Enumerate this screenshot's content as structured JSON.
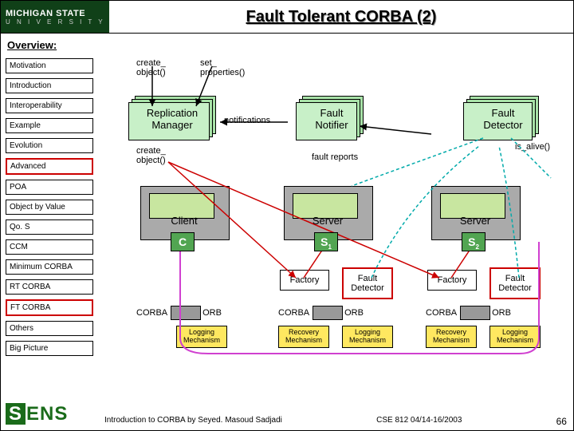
{
  "header": {
    "logo_line1": "MICHIGAN STATE",
    "logo_line2": "U N I V E R S I T Y",
    "title": "Fault Tolerant CORBA (2)"
  },
  "subtitle": "Overview:",
  "sidebar": {
    "items": [
      {
        "label": "Motivation",
        "hl": false
      },
      {
        "label": "Introduction",
        "hl": false
      },
      {
        "label": "Interoperability",
        "hl": false
      },
      {
        "label": "Example",
        "hl": false
      },
      {
        "label": "Evolution",
        "hl": false
      },
      {
        "label": "Advanced",
        "hl": true
      },
      {
        "label": "POA",
        "hl": false
      },
      {
        "label": "Object by Value",
        "hl": false
      },
      {
        "label": "Qo. S",
        "hl": false
      },
      {
        "label": "CCM",
        "hl": false
      },
      {
        "label": "Minimum CORBA",
        "hl": false
      },
      {
        "label": "RT CORBA",
        "hl": false
      },
      {
        "label": "FT CORBA",
        "hl": true
      },
      {
        "label": "Others",
        "hl": false
      }
    ],
    "big_picture": "Big Picture"
  },
  "diagram": {
    "create_obj_top": "create_\nobject()",
    "set_props": "set_\nproperties()",
    "replication_mgr": "Replication\nManager",
    "notifications": "notifications",
    "fault_notifier": "Fault\nNotifier",
    "fault_detector_top": "Fault\nDetector",
    "create_obj_mid": "create_\nobject()",
    "fault_reports": "fault reports",
    "is_alive": "is_alive()",
    "client": "Client",
    "server1": "Server",
    "server2": "Server",
    "client_chip": "C",
    "s1_chip": "S",
    "s1_sub": "1",
    "s2_chip": "S",
    "s2_sub": "2",
    "factory1": "Factory",
    "fault_det1": "Fault\nDetector",
    "factory2": "Factory",
    "fault_det2": "Fault\nDetector",
    "corba": "CORBA",
    "orb": "ORB",
    "logging": "Logging\nMechanism",
    "recovery": "Recovery\nMechanism"
  },
  "footer": {
    "left": "Introduction to CORBA by Seyed. Masoud Sadjadi",
    "right": "CSE 812   04/14-16/2003",
    "page": "66"
  }
}
